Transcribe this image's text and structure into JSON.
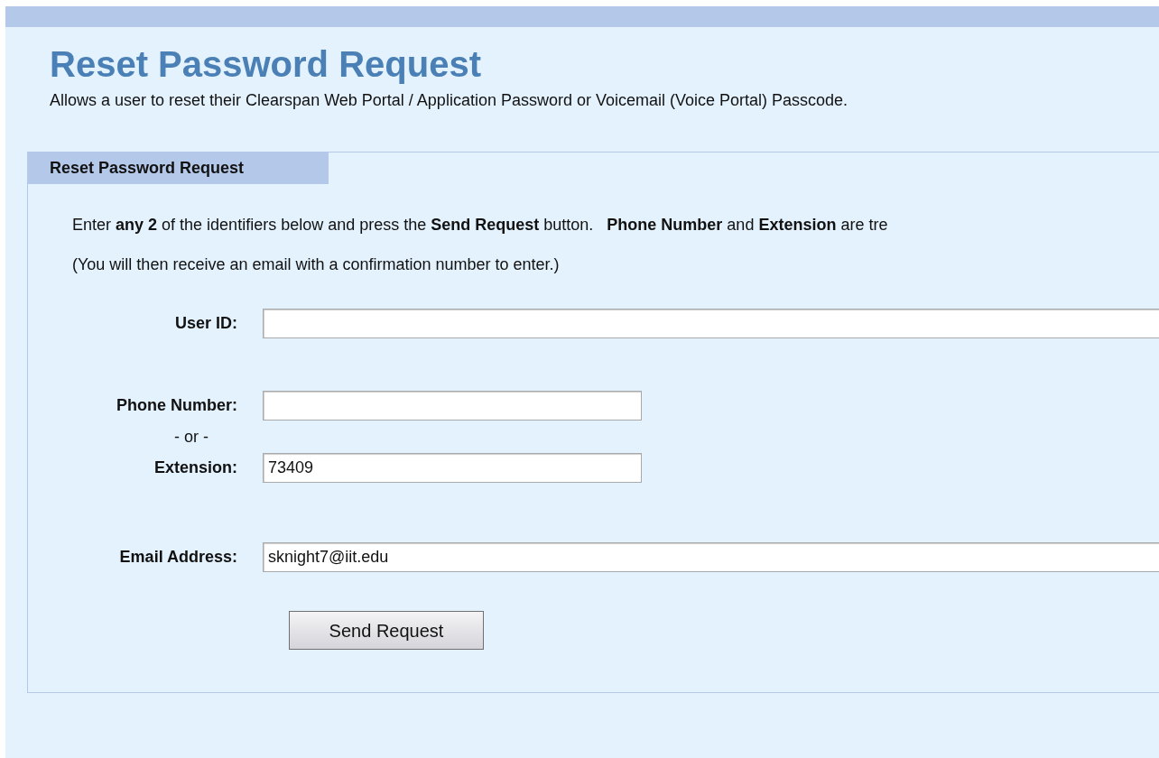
{
  "title": "Reset Password Request",
  "subtitle": "Allows a user to reset their Clearspan Web Portal / Application Password or Voicemail (Voice Portal) Passcode.",
  "panel": {
    "tab": "Reset Password Request",
    "instructions": [
      "Enter **any 2** of the identifiers below and press the **Send Request** button.   **Phone Number** and **Extension** are tre",
      "(You will then receive an email with a confirmation number to enter.)"
    ],
    "rows": [
      {
        "kind": "field",
        "label": "User ID:",
        "value": "",
        "wide": true
      },
      {
        "kind": "field",
        "label": "Phone Number:",
        "value": "",
        "wide": false
      },
      {
        "kind": "separator",
        "label": "- or -"
      },
      {
        "kind": "field",
        "label": "Extension:",
        "value": "73409",
        "wide": false
      },
      {
        "kind": "field",
        "label": "Email Address:",
        "value": "sknight7@iit.edu",
        "wide": true
      }
    ],
    "button": "Send Request"
  }
}
